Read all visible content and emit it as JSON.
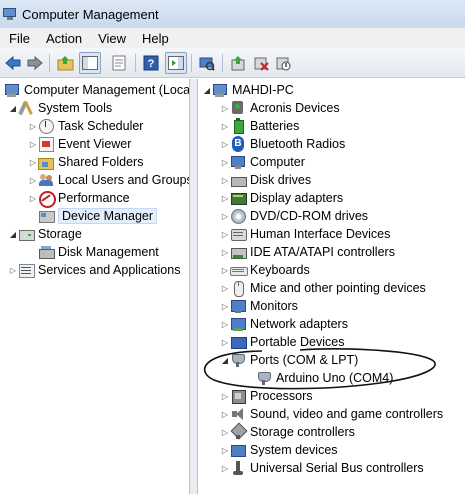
{
  "window": {
    "title": "Computer Management"
  },
  "menu": [
    "File",
    "Action",
    "View",
    "Help"
  ],
  "toolbar": {
    "buttons": [
      "back-icon",
      "forward-icon",
      "up-folder-icon",
      "show-hide-tree-icon",
      "properties-icon",
      "help-icon",
      "show-hide-action-pane-icon",
      "scan-hardware-icon",
      "update-driver-icon",
      "uninstall-icon",
      "disable-icon"
    ]
  },
  "left_tree": {
    "root": "Computer Management (Local",
    "system_tools": "System Tools",
    "task_scheduler": "Task Scheduler",
    "event_viewer": "Event Viewer",
    "shared_folders": "Shared Folders",
    "local_users": "Local Users and Groups",
    "performance": "Performance",
    "device_manager": "Device Manager",
    "storage": "Storage",
    "disk_management": "Disk Management",
    "services": "Services and Applications"
  },
  "device_tree": {
    "computer_name": "MAHDI-PC",
    "categories": [
      "Acronis Devices",
      "Batteries",
      "Bluetooth Radios",
      "Computer",
      "Disk drives",
      "Display adapters",
      "DVD/CD-ROM drives",
      "Human Interface Devices",
      "IDE ATA/ATAPI controllers",
      "Keyboards",
      "Mice and other pointing devices",
      "Monitors",
      "Network adapters",
      "Portable Devices",
      "Ports (COM & LPT)",
      "Processors",
      "Sound, video and game controllers",
      "Storage controllers",
      "System devices",
      "Universal Serial Bus controllers"
    ],
    "port_child": "Arduino Uno (COM4)"
  }
}
